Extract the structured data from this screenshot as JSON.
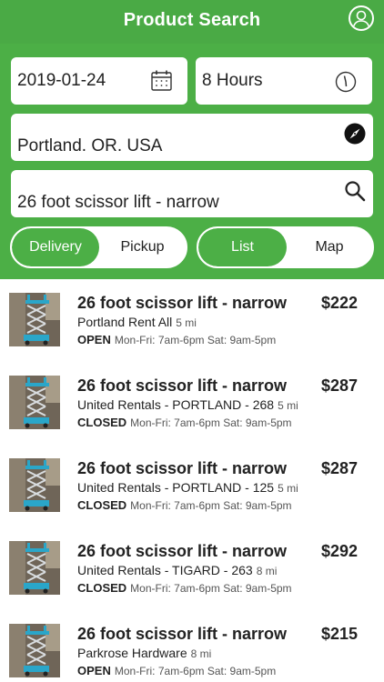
{
  "header": {
    "title": "Product Search",
    "profile_icon": "user-icon"
  },
  "search_form": {
    "date_value": "2019-01-24",
    "date_icon": "calendar-icon",
    "duration_value": "8 Hours",
    "duration_icon": "clock-icon",
    "location_value": "Portland. OR. USA",
    "location_icon": "compass-icon",
    "query_value": "26 foot scissor lift - narrow",
    "query_icon": "search-icon"
  },
  "fulfillment_toggle": {
    "active": "Delivery",
    "inactive": "Pickup"
  },
  "view_toggle": {
    "active": "List",
    "inactive": "Map"
  },
  "colors": {
    "brand_green": "#4caf46",
    "header_green": "#4aaa45"
  },
  "results": [
    {
      "title": "26 foot scissor lift - narrow",
      "price": "$222",
      "vendor": "Portland Rent All",
      "distance": "5 mi",
      "status": "OPEN",
      "hours": "Mon-Fri: 7am-6pm Sat: 9am-5pm"
    },
    {
      "title": "26 foot scissor lift - narrow",
      "price": "$287",
      "vendor": "United Rentals - PORTLAND - 268",
      "distance": "5 mi",
      "status": "CLOSED",
      "hours": "Mon-Fri: 7am-6pm Sat: 9am-5pm"
    },
    {
      "title": "26 foot scissor lift - narrow",
      "price": "$287",
      "vendor": "United Rentals - PORTLAND - 125",
      "distance": "5 mi",
      "status": "CLOSED",
      "hours": "Mon-Fri: 7am-6pm Sat: 9am-5pm"
    },
    {
      "title": "26 foot scissor lift - narrow",
      "price": "$292",
      "vendor": "United Rentals - TIGARD - 263",
      "distance": "8 mi",
      "status": "CLOSED",
      "hours": "Mon-Fri: 7am-6pm Sat: 9am-5pm"
    },
    {
      "title": "26 foot scissor lift - narrow",
      "price": "$215",
      "vendor": "Parkrose Hardware",
      "distance": "8 mi",
      "status": "OPEN",
      "hours": "Mon-Fri: 7am-6pm Sat: 9am-5pm"
    }
  ]
}
